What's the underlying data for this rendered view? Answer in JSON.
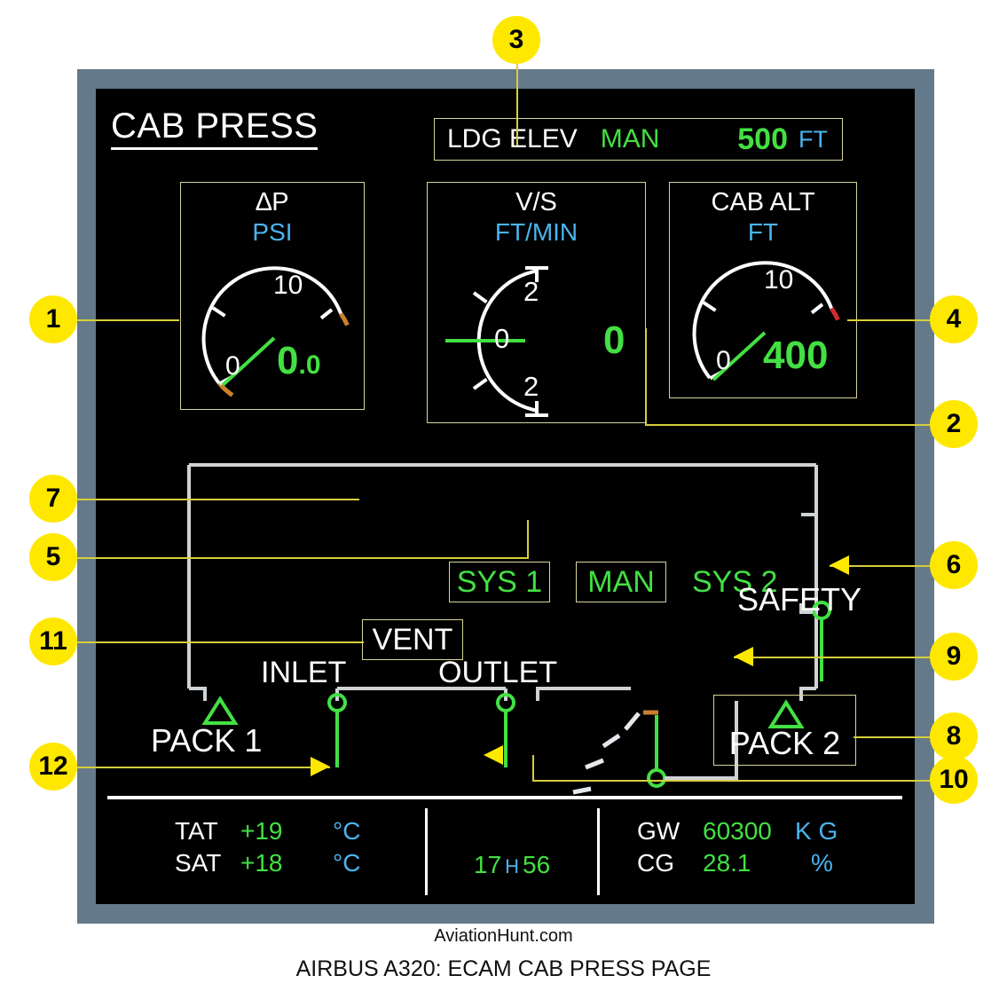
{
  "caption": {
    "site": "AviationHunt.com",
    "title": "AIRBUS A320: ECAM CAB PRESS PAGE"
  },
  "display": {
    "page_title": "CAB PRESS",
    "ldg_elev": {
      "label": "LDG ELEV",
      "mode": "MAN",
      "value": "500",
      "unit": "FT"
    },
    "gauges": [
      {
        "id": "delta-p",
        "title": "∆P",
        "unit": "PSI",
        "ticks": [
          "0",
          "10"
        ],
        "value_int": "0",
        "value_frac": ".0",
        "limit_color": "#c8812a",
        "needle_color": "#43e043"
      },
      {
        "id": "vertical-speed",
        "title": "V/S",
        "unit": "FT/MIN",
        "ticks": [
          "2",
          "0",
          "2"
        ],
        "value_int": "0",
        "value_frac": "",
        "limit_color": "",
        "needle_color": "#43e043"
      },
      {
        "id": "cab-alt",
        "title": "CAB ALT",
        "unit": "FT",
        "ticks": [
          "0",
          "10"
        ],
        "value_int": "400",
        "value_frac": "",
        "limit_color": "#d42b2b",
        "needle_color": "#43e043"
      }
    ],
    "schematic": {
      "sys1": "SYS 1",
      "man": "MAN",
      "sys2": "SYS 2",
      "safety": "SAFETY",
      "vent": "VENT",
      "inlet": "INLET",
      "outlet": "OUTLET",
      "pack1": "PACK 1",
      "pack2": "PACK 2"
    },
    "databar": {
      "tat": {
        "key": "TAT",
        "value": "+19",
        "unit": "°C"
      },
      "sat": {
        "key": "SAT",
        "value": "+18",
        "unit": "°C"
      },
      "clock": {
        "hours": "17",
        "sep": "H",
        "minutes": "56"
      },
      "gw": {
        "key": "GW",
        "value": "60300",
        "unit": "K G"
      },
      "cg": {
        "key": "CG",
        "value": "28.1",
        "unit": "%"
      }
    }
  },
  "callouts": [
    {
      "n": "1"
    },
    {
      "n": "2"
    },
    {
      "n": "3"
    },
    {
      "n": "4"
    },
    {
      "n": "5"
    },
    {
      "n": "6"
    },
    {
      "n": "7"
    },
    {
      "n": "8"
    },
    {
      "n": "9"
    },
    {
      "n": "10"
    },
    {
      "n": "11"
    },
    {
      "n": "12"
    }
  ],
  "colors": {
    "green": "#43e043",
    "blue": "#4ab4ee",
    "amber": "#c8812a",
    "red": "#d42b2b",
    "badge": "#ffe800",
    "bezel": "#64798a",
    "box_border": "#d8d49a"
  }
}
